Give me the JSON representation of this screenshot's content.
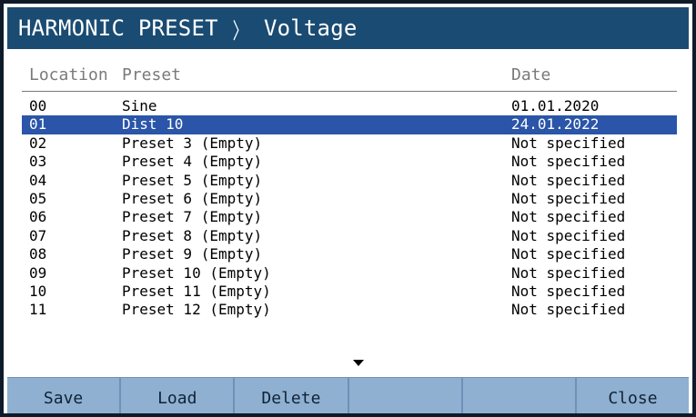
{
  "title": {
    "section": "HARMONIC PRESET",
    "separator": "〉",
    "page": "Voltage"
  },
  "columns": {
    "location": "Location",
    "preset": "Preset",
    "date": "Date"
  },
  "rows": [
    {
      "location": "00",
      "preset": "Sine",
      "date": "01.01.2020"
    },
    {
      "location": "01",
      "preset": "Dist 10",
      "date": "24.01.2022",
      "selected": true
    },
    {
      "location": "02",
      "preset": "Preset 3 (Empty)",
      "date": "Not specified"
    },
    {
      "location": "03",
      "preset": "Preset 4 (Empty)",
      "date": "Not specified"
    },
    {
      "location": "04",
      "preset": "Preset 5 (Empty)",
      "date": "Not specified"
    },
    {
      "location": "05",
      "preset": "Preset 6 (Empty)",
      "date": "Not specified"
    },
    {
      "location": "06",
      "preset": "Preset 7 (Empty)",
      "date": "Not specified"
    },
    {
      "location": "07",
      "preset": "Preset 8 (Empty)",
      "date": "Not specified"
    },
    {
      "location": "08",
      "preset": "Preset 9 (Empty)",
      "date": "Not specified"
    },
    {
      "location": "09",
      "preset": "Preset 10 (Empty)",
      "date": "Not specified"
    },
    {
      "location": "10",
      "preset": "Preset 11 (Empty)",
      "date": "Not specified"
    },
    {
      "location": "11",
      "preset": "Preset 12 (Empty)",
      "date": "Not specified"
    }
  ],
  "softkeys": [
    "Save",
    "Load",
    "Delete",
    "",
    "",
    "Close"
  ],
  "icons": {
    "scroll_down": "triangle-down-icon"
  },
  "colors": {
    "title_bg": "#1a4b72",
    "selected_row": "#2a55a8",
    "softkey_bg": "#8fb0d0"
  }
}
